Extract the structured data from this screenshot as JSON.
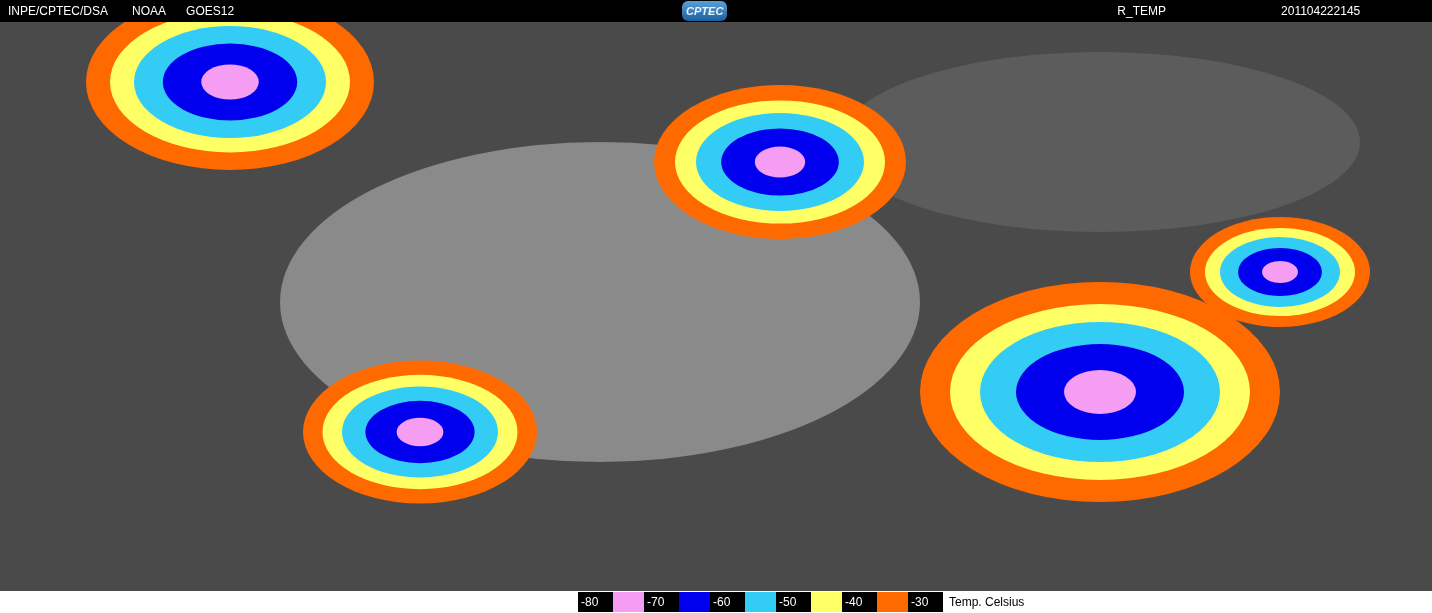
{
  "header": {
    "left": [
      "INPE/CPTEC/DSA",
      "NOAA",
      "GOES12"
    ],
    "logo": "CPTEC",
    "product": "R_TEMP",
    "timestamp": "201104222145"
  },
  "legend": {
    "bins": [
      {
        "label": "-80",
        "color": "#f59cf3"
      },
      {
        "label": "-70",
        "color": "#0000ee"
      },
      {
        "label": "-60",
        "color": "#33ccf5"
      },
      {
        "label": "-50",
        "color": "#ffff66"
      },
      {
        "label": "-40",
        "color": "#ff6a00"
      },
      {
        "label": "-30"
      }
    ],
    "unit": "Temp. Celsius"
  }
}
